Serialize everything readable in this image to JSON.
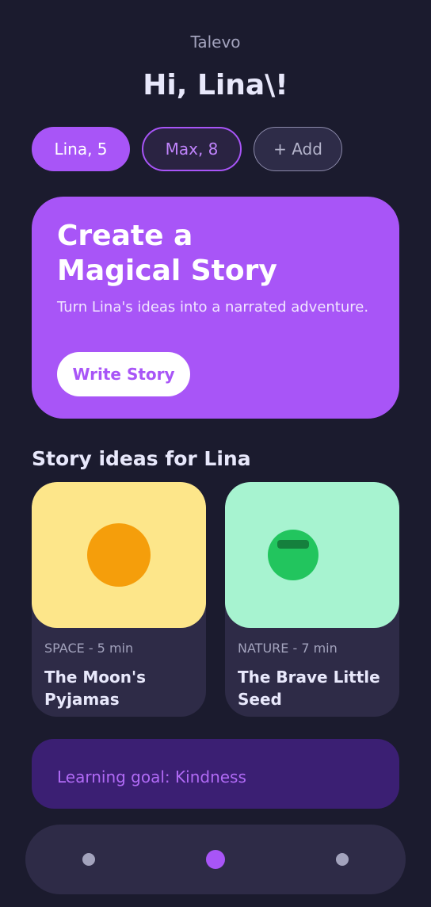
{
  "app": {
    "name": "Talevo"
  },
  "greeting": "Hi, Lina\\!",
  "profiles": [
    {
      "label": "Lina, 5",
      "state": "selected"
    },
    {
      "label": "Max, 8",
      "state": "outlined"
    },
    {
      "label": "+ Add",
      "state": "add"
    }
  ],
  "hero": {
    "title": "Create a Magical Story",
    "subtitle": "Turn Lina's ideas into a narrated adventure.",
    "button_label": "Write Story"
  },
  "ideas": {
    "section_title": "Story ideas for Lina",
    "cards": [
      {
        "meta": "SPACE - 5 min",
        "title": "The Moon's Pyjamas",
        "art_icon": "sun-icon",
        "art_color": "#fde68a"
      },
      {
        "meta": "NATURE - 7 min",
        "title": "The Brave Little Seed",
        "art_icon": "seed-icon",
        "art_color": "#a7f3d0"
      }
    ]
  },
  "goal": {
    "text": "Learning goal: Kindness"
  },
  "nav": {
    "items": [
      {
        "icon": "nav-dot-icon",
        "active": false
      },
      {
        "icon": "nav-dot-icon",
        "active": true
      },
      {
        "icon": "nav-dot-icon",
        "active": false
      }
    ]
  },
  "colors": {
    "background": "#1b1b2e",
    "accent": "#a855f7",
    "surface": "#2e2b47",
    "goal_background": "#3b1f73"
  }
}
